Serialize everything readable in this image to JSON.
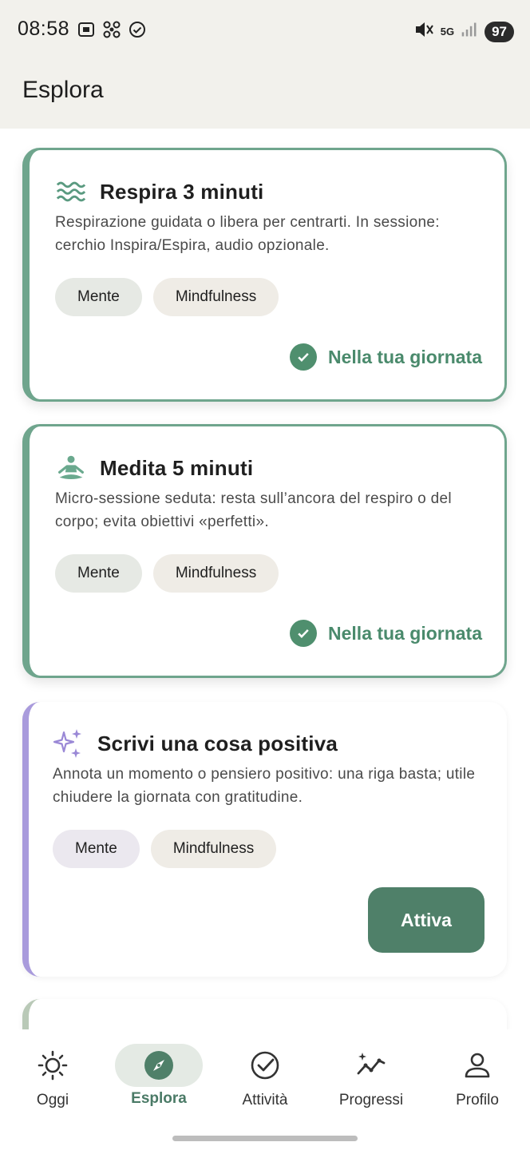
{
  "status_bar": {
    "time": "08:58",
    "network": "5G",
    "battery": "97",
    "left_icons": [
      "screenshot-icon",
      "fan-icon",
      "check-circle-icon"
    ],
    "right_icons": [
      "mute-icon",
      "signal-icon"
    ]
  },
  "header": {
    "title": "Esplora"
  },
  "cards": [
    {
      "title": "Respira 3 minuti",
      "icon": "waves-icon",
      "description": "Respirazione guidata o libera per centrarti. In sessione: cerchio Inspira/Espira, audio opzionale.",
      "chips": [
        "Mente",
        "Mindfulness"
      ],
      "status": "Nella tua giornata",
      "accent": "#6fa58d"
    },
    {
      "title": "Medita 5 minuti",
      "icon": "meditation-icon",
      "description": "Micro-sessione seduta: resta sull’ancora del respiro o del corpo; evita obiettivi «perfetti».",
      "chips": [
        "Mente",
        "Mindfulness"
      ],
      "status": "Nella tua giornata",
      "accent": "#6fa58d"
    },
    {
      "title": "Scrivi una cosa positiva",
      "icon": "sparkles-icon",
      "description": "Annota un momento o pensiero positivo: una riga basta; utile chiudere la giornata con gratitudine.",
      "chips": [
        "Mente",
        "Mindfulness"
      ],
      "action": "Attiva",
      "accent": "#a99bdc"
    }
  ],
  "bottom_nav": [
    {
      "label": "Oggi",
      "icon": "sun-icon"
    },
    {
      "label": "Esplora",
      "icon": "compass-icon",
      "active": true
    },
    {
      "label": "Attività",
      "icon": "check-circle-icon"
    },
    {
      "label": "Progressi",
      "icon": "trend-sparkle-icon"
    },
    {
      "label": "Profilo",
      "icon": "person-icon"
    }
  ],
  "colors": {
    "header_bg": "#f2f1ec",
    "primary_green": "#4f8069",
    "status_green": "#4a8a6c",
    "lavender_accent": "#a99bdc"
  }
}
